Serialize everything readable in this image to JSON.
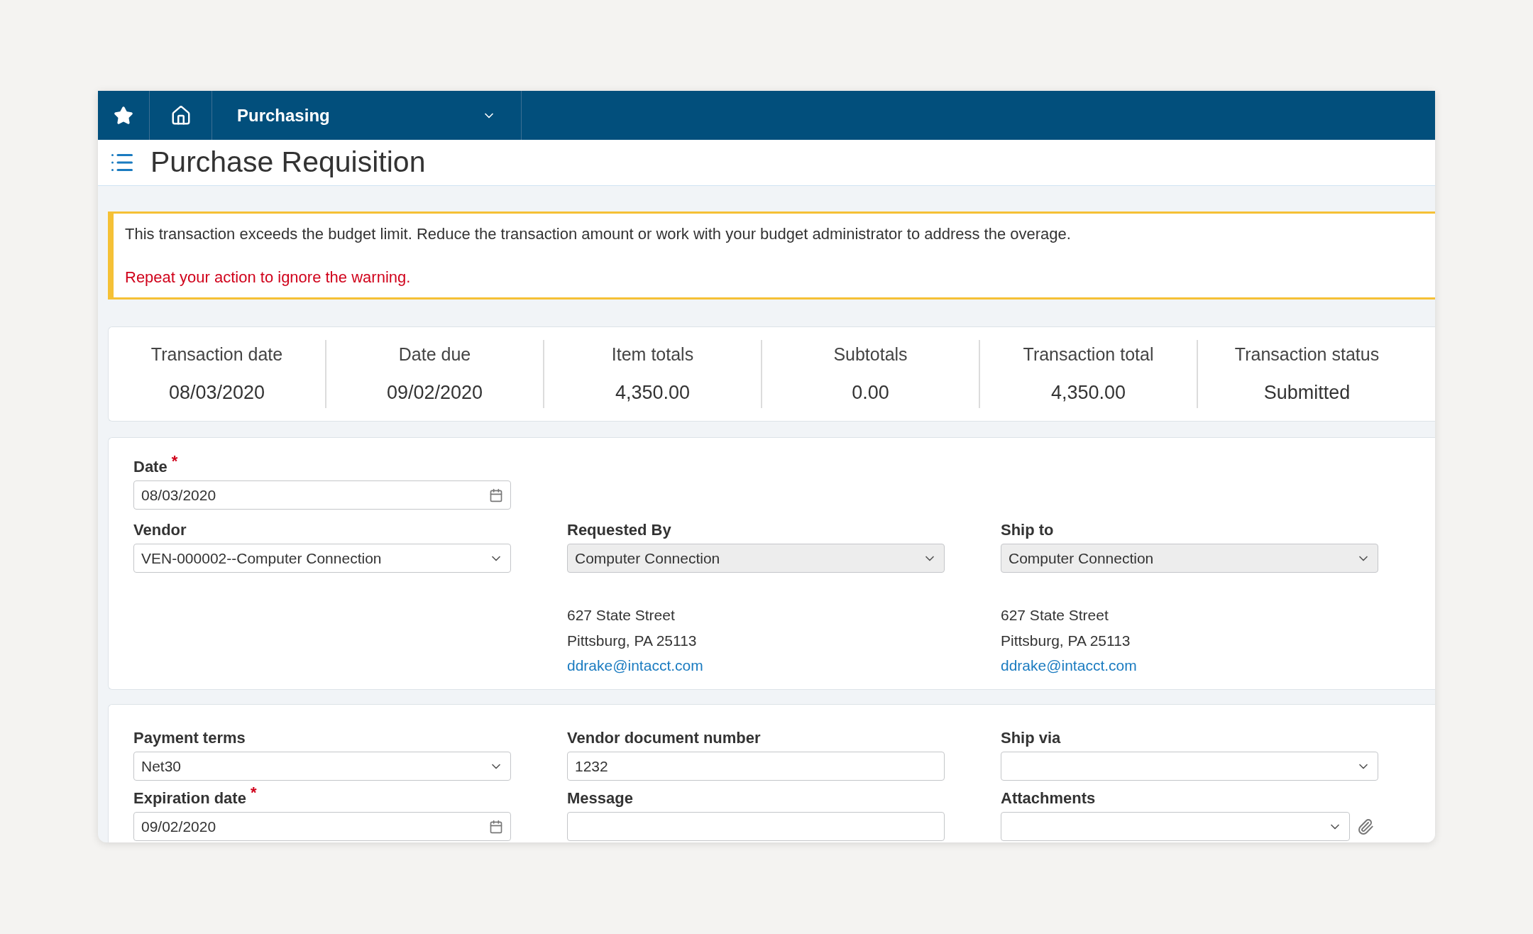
{
  "nav": {
    "module": "Purchasing"
  },
  "page": {
    "title": "Purchase Requisition"
  },
  "warning": {
    "message": "This transaction exceeds the budget limit. Reduce the transaction amount or work with your budget administrator to address the overage.",
    "hint": "Repeat your action to ignore the warning."
  },
  "summary": [
    {
      "label": "Transaction date",
      "value": "08/03/2020"
    },
    {
      "label": "Date due",
      "value": "09/02/2020"
    },
    {
      "label": "Item totals",
      "value": "4,350.00"
    },
    {
      "label": "Subtotals",
      "value": "0.00"
    },
    {
      "label": "Transaction total",
      "value": "4,350.00"
    },
    {
      "label": "Transaction status",
      "value": "Submitted"
    }
  ],
  "header_section": {
    "top_field": {
      "kind": "date",
      "label": "Date",
      "value": "08/03/2020",
      "required_mark": "*",
      "disabled": false
    },
    "columns": [
      {
        "field": {
          "kind": "select",
          "label": "Vendor",
          "value": "VEN-000002--Computer Connection",
          "disabled": false
        }
      },
      {
        "field": {
          "kind": "select",
          "label": "Requested By",
          "value": "Computer Connection",
          "disabled": true
        },
        "address": [
          "627 State Street",
          "Pittsburg, PA 25113"
        ],
        "email": "ddrake@intacct.com"
      },
      {
        "field": {
          "kind": "select",
          "label": "Ship to",
          "value": "Computer Connection",
          "disabled": true
        },
        "address": [
          "627 State Street",
          "Pittsburg, PA 25113"
        ],
        "email": "ddrake@intacct.com"
      }
    ]
  },
  "details_section": {
    "rows": [
      [
        {
          "kind": "select",
          "label": "Payment terms",
          "value": "Net30",
          "disabled": false
        },
        {
          "kind": "text",
          "label": "Vendor document number",
          "value": "1232",
          "disabled": false
        },
        {
          "kind": "select",
          "label": "Ship via",
          "disabled": false
        }
      ],
      [
        {
          "kind": "date",
          "label": "Expiration date",
          "value": "09/02/2020",
          "required_mark": "*",
          "disabled": false
        },
        {
          "kind": "text",
          "label": "Message",
          "disabled": false
        },
        {
          "kind": "attachment",
          "label": "Attachments",
          "disabled": false
        }
      ]
    ]
  }
}
